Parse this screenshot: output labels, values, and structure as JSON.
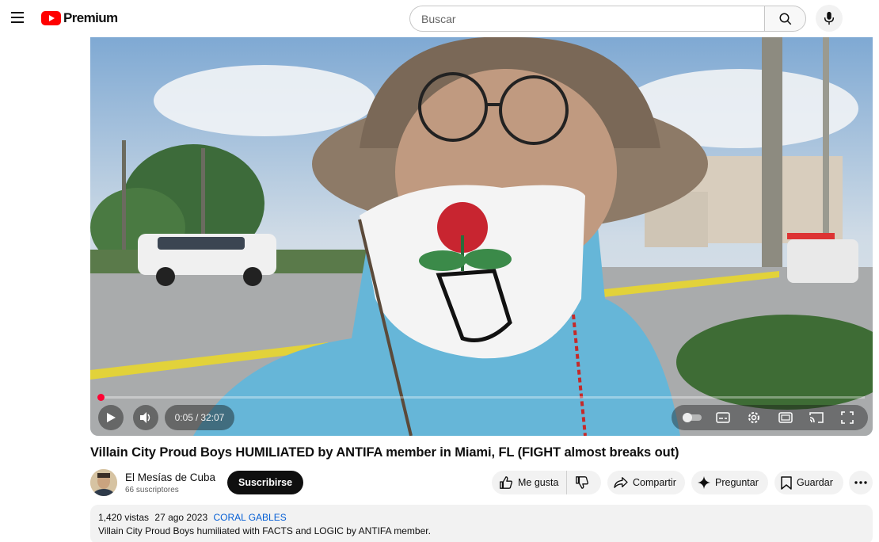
{
  "brand": {
    "logo_text": "Premium",
    "accent": "#ff0000"
  },
  "search": {
    "placeholder": "Buscar"
  },
  "player": {
    "current_time": "0:05",
    "duration": "32:07",
    "progress_fraction": 0.003,
    "time_display": "0:05 / 32:07"
  },
  "video": {
    "title": "Villain City Proud Boys HUMILIATED by ANTIFA member in Miami, FL (FIGHT almost breaks out)"
  },
  "channel": {
    "name": "El Mesías de Cuba",
    "subscribers": "66 suscriptores",
    "subscribe_label": "Suscribirse"
  },
  "actions": {
    "like_label": "Me gusta",
    "share_label": "Compartir",
    "ask_label": "Preguntar",
    "save_label": "Guardar"
  },
  "description": {
    "views": "1,420 vistas",
    "date": "27 ago 2023",
    "tag": "CORAL GABLES",
    "text": "Villain City Proud Boys humiliated with FACTS and LOGIC by ANTIFA member."
  },
  "icons": [
    "menu-icon",
    "youtube-logo-icon",
    "search-icon",
    "mic-icon",
    "play-icon",
    "volume-icon",
    "autoplay-toggle-icon",
    "subtitles-icon",
    "settings-icon",
    "theater-icon",
    "cast-icon",
    "fullscreen-icon",
    "thumbs-up-icon",
    "thumbs-down-icon",
    "share-icon",
    "sparkle-icon",
    "bookmark-icon",
    "more-icon"
  ]
}
